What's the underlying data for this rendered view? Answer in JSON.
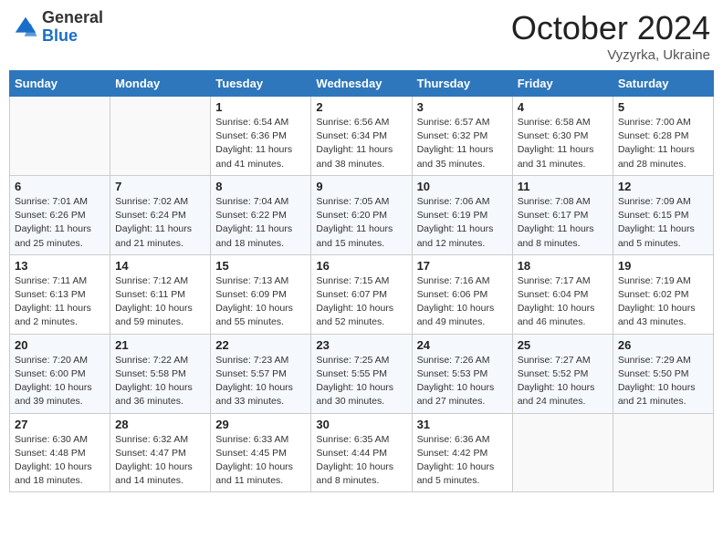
{
  "header": {
    "logo_general": "General",
    "logo_blue": "Blue",
    "month": "October 2024",
    "location": "Vyzyrka, Ukraine"
  },
  "days_of_week": [
    "Sunday",
    "Monday",
    "Tuesday",
    "Wednesday",
    "Thursday",
    "Friday",
    "Saturday"
  ],
  "weeks": [
    [
      {
        "day": "",
        "sunrise": "",
        "sunset": "",
        "daylight": ""
      },
      {
        "day": "",
        "sunrise": "",
        "sunset": "",
        "daylight": ""
      },
      {
        "day": "1",
        "sunrise": "Sunrise: 6:54 AM",
        "sunset": "Sunset: 6:36 PM",
        "daylight": "Daylight: 11 hours and 41 minutes."
      },
      {
        "day": "2",
        "sunrise": "Sunrise: 6:56 AM",
        "sunset": "Sunset: 6:34 PM",
        "daylight": "Daylight: 11 hours and 38 minutes."
      },
      {
        "day": "3",
        "sunrise": "Sunrise: 6:57 AM",
        "sunset": "Sunset: 6:32 PM",
        "daylight": "Daylight: 11 hours and 35 minutes."
      },
      {
        "day": "4",
        "sunrise": "Sunrise: 6:58 AM",
        "sunset": "Sunset: 6:30 PM",
        "daylight": "Daylight: 11 hours and 31 minutes."
      },
      {
        "day": "5",
        "sunrise": "Sunrise: 7:00 AM",
        "sunset": "Sunset: 6:28 PM",
        "daylight": "Daylight: 11 hours and 28 minutes."
      }
    ],
    [
      {
        "day": "6",
        "sunrise": "Sunrise: 7:01 AM",
        "sunset": "Sunset: 6:26 PM",
        "daylight": "Daylight: 11 hours and 25 minutes."
      },
      {
        "day": "7",
        "sunrise": "Sunrise: 7:02 AM",
        "sunset": "Sunset: 6:24 PM",
        "daylight": "Daylight: 11 hours and 21 minutes."
      },
      {
        "day": "8",
        "sunrise": "Sunrise: 7:04 AM",
        "sunset": "Sunset: 6:22 PM",
        "daylight": "Daylight: 11 hours and 18 minutes."
      },
      {
        "day": "9",
        "sunrise": "Sunrise: 7:05 AM",
        "sunset": "Sunset: 6:20 PM",
        "daylight": "Daylight: 11 hours and 15 minutes."
      },
      {
        "day": "10",
        "sunrise": "Sunrise: 7:06 AM",
        "sunset": "Sunset: 6:19 PM",
        "daylight": "Daylight: 11 hours and 12 minutes."
      },
      {
        "day": "11",
        "sunrise": "Sunrise: 7:08 AM",
        "sunset": "Sunset: 6:17 PM",
        "daylight": "Daylight: 11 hours and 8 minutes."
      },
      {
        "day": "12",
        "sunrise": "Sunrise: 7:09 AM",
        "sunset": "Sunset: 6:15 PM",
        "daylight": "Daylight: 11 hours and 5 minutes."
      }
    ],
    [
      {
        "day": "13",
        "sunrise": "Sunrise: 7:11 AM",
        "sunset": "Sunset: 6:13 PM",
        "daylight": "Daylight: 11 hours and 2 minutes."
      },
      {
        "day": "14",
        "sunrise": "Sunrise: 7:12 AM",
        "sunset": "Sunset: 6:11 PM",
        "daylight": "Daylight: 10 hours and 59 minutes."
      },
      {
        "day": "15",
        "sunrise": "Sunrise: 7:13 AM",
        "sunset": "Sunset: 6:09 PM",
        "daylight": "Daylight: 10 hours and 55 minutes."
      },
      {
        "day": "16",
        "sunrise": "Sunrise: 7:15 AM",
        "sunset": "Sunset: 6:07 PM",
        "daylight": "Daylight: 10 hours and 52 minutes."
      },
      {
        "day": "17",
        "sunrise": "Sunrise: 7:16 AM",
        "sunset": "Sunset: 6:06 PM",
        "daylight": "Daylight: 10 hours and 49 minutes."
      },
      {
        "day": "18",
        "sunrise": "Sunrise: 7:17 AM",
        "sunset": "Sunset: 6:04 PM",
        "daylight": "Daylight: 10 hours and 46 minutes."
      },
      {
        "day": "19",
        "sunrise": "Sunrise: 7:19 AM",
        "sunset": "Sunset: 6:02 PM",
        "daylight": "Daylight: 10 hours and 43 minutes."
      }
    ],
    [
      {
        "day": "20",
        "sunrise": "Sunrise: 7:20 AM",
        "sunset": "Sunset: 6:00 PM",
        "daylight": "Daylight: 10 hours and 39 minutes."
      },
      {
        "day": "21",
        "sunrise": "Sunrise: 7:22 AM",
        "sunset": "Sunset: 5:58 PM",
        "daylight": "Daylight: 10 hours and 36 minutes."
      },
      {
        "day": "22",
        "sunrise": "Sunrise: 7:23 AM",
        "sunset": "Sunset: 5:57 PM",
        "daylight": "Daylight: 10 hours and 33 minutes."
      },
      {
        "day": "23",
        "sunrise": "Sunrise: 7:25 AM",
        "sunset": "Sunset: 5:55 PM",
        "daylight": "Daylight: 10 hours and 30 minutes."
      },
      {
        "day": "24",
        "sunrise": "Sunrise: 7:26 AM",
        "sunset": "Sunset: 5:53 PM",
        "daylight": "Daylight: 10 hours and 27 minutes."
      },
      {
        "day": "25",
        "sunrise": "Sunrise: 7:27 AM",
        "sunset": "Sunset: 5:52 PM",
        "daylight": "Daylight: 10 hours and 24 minutes."
      },
      {
        "day": "26",
        "sunrise": "Sunrise: 7:29 AM",
        "sunset": "Sunset: 5:50 PM",
        "daylight": "Daylight: 10 hours and 21 minutes."
      }
    ],
    [
      {
        "day": "27",
        "sunrise": "Sunrise: 6:30 AM",
        "sunset": "Sunset: 4:48 PM",
        "daylight": "Daylight: 10 hours and 18 minutes."
      },
      {
        "day": "28",
        "sunrise": "Sunrise: 6:32 AM",
        "sunset": "Sunset: 4:47 PM",
        "daylight": "Daylight: 10 hours and 14 minutes."
      },
      {
        "day": "29",
        "sunrise": "Sunrise: 6:33 AM",
        "sunset": "Sunset: 4:45 PM",
        "daylight": "Daylight: 10 hours and 11 minutes."
      },
      {
        "day": "30",
        "sunrise": "Sunrise: 6:35 AM",
        "sunset": "Sunset: 4:44 PM",
        "daylight": "Daylight: 10 hours and 8 minutes."
      },
      {
        "day": "31",
        "sunrise": "Sunrise: 6:36 AM",
        "sunset": "Sunset: 4:42 PM",
        "daylight": "Daylight: 10 hours and 5 minutes."
      },
      {
        "day": "",
        "sunrise": "",
        "sunset": "",
        "daylight": ""
      },
      {
        "day": "",
        "sunrise": "",
        "sunset": "",
        "daylight": ""
      }
    ]
  ]
}
